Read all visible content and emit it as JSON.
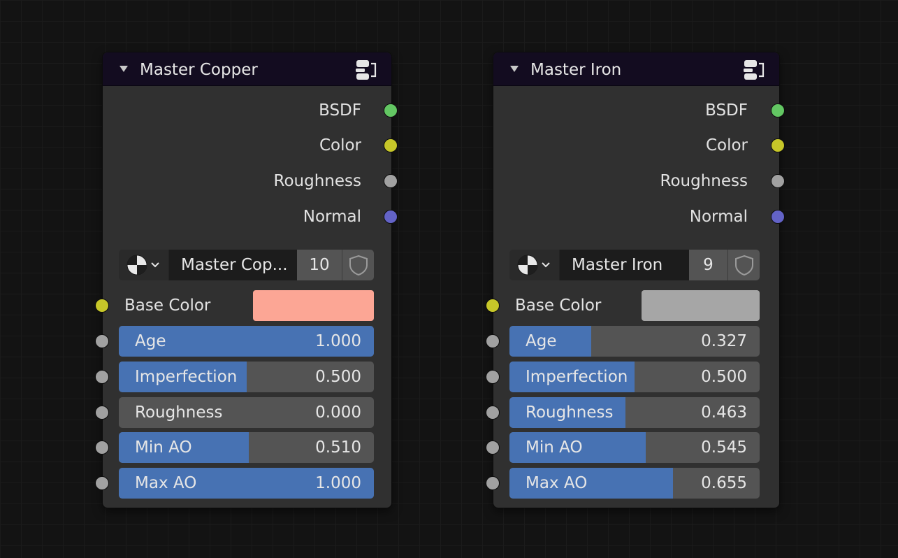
{
  "colors": {
    "bsdf_socket": "#63c763",
    "color_socket": "#c7c729",
    "float_socket": "#a1a1a1",
    "vector_socket": "#6363c7",
    "slider_fill": "#4772b3",
    "slider_bg": "#545454",
    "header_bg": "#130c20",
    "node_bg": "#303030"
  },
  "nodes": [
    {
      "title": "Master Copper",
      "header_icon": "node-group-icon",
      "outputs": [
        "BSDF",
        "Color",
        "Roughness",
        "Normal"
      ],
      "datablock": {
        "browse_icon": "shader-sphere-icon",
        "name": "Master Cop...",
        "users": "10",
        "fake_user_icon": "shield-icon"
      },
      "base_color": {
        "label": "Base Color",
        "swatch": "#fca695"
      },
      "sliders": [
        {
          "label": "Age",
          "value": "1.000",
          "fraction": 1.0
        },
        {
          "label": "Imperfection",
          "value": "0.500",
          "fraction": 0.5
        },
        {
          "label": "Roughness",
          "value": "0.000",
          "fraction": 0.0
        },
        {
          "label": "Min AO",
          "value": "0.510",
          "fraction": 0.51
        },
        {
          "label": "Max AO",
          "value": "1.000",
          "fraction": 1.0
        }
      ]
    },
    {
      "title": "Master Iron",
      "header_icon": "node-group-icon",
      "outputs": [
        "BSDF",
        "Color",
        "Roughness",
        "Normal"
      ],
      "datablock": {
        "browse_icon": "shader-sphere-icon",
        "name": "Master Iron",
        "users": "9",
        "fake_user_icon": "shield-icon"
      },
      "base_color": {
        "label": "Base Color",
        "swatch": "#a6a6a6"
      },
      "sliders": [
        {
          "label": "Age",
          "value": "0.327",
          "fraction": 0.327
        },
        {
          "label": "Imperfection",
          "value": "0.500",
          "fraction": 0.5
        },
        {
          "label": "Roughness",
          "value": "0.463",
          "fraction": 0.463
        },
        {
          "label": "Min AO",
          "value": "0.545",
          "fraction": 0.545
        },
        {
          "label": "Max AO",
          "value": "0.655",
          "fraction": 0.655
        }
      ]
    }
  ]
}
